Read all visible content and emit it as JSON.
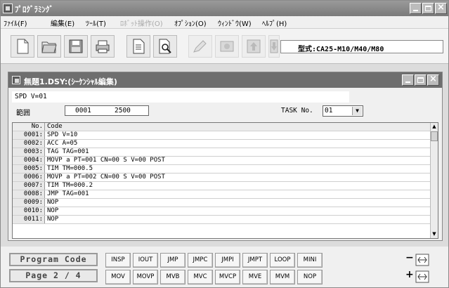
{
  "app": {
    "title": "ﾌﾟﾛｸﾞﾗﾐﾝｸﾞ"
  },
  "menu": [
    {
      "label": "ﾌｧｲﾙ(F)",
      "enabled": true
    },
    {
      "label": "編集(E)",
      "enabled": true
    },
    {
      "label": "ﾂｰﾙ(T)",
      "enabled": true
    },
    {
      "label": "ﾛﾎﾞｯﾄ操作(O)",
      "enabled": false
    },
    {
      "label": "ｵﾌﾟｼｮﾝ(O)",
      "enabled": true
    },
    {
      "label": "ｳｨﾝﾄﾞｳ(W)",
      "enabled": true
    },
    {
      "label": "ﾍﾙﾌﾟ(H)",
      "enabled": true
    }
  ],
  "toolbar": {
    "buttons": [
      "new-icon",
      "open-icon",
      "save-icon",
      "print-icon",
      "document-icon",
      "search-icon",
      "edit-icon",
      "record-icon",
      "upload-icon",
      "download-icon"
    ],
    "model_text": "型式:CA25-M10/M40/M80"
  },
  "editor": {
    "title": "無題1.DSY:(ｼｰｹﾝｼｬﾙ編集)",
    "speed_line": "SPD V=01",
    "range_label": "範囲",
    "range_start": "0001",
    "range_end": "2500",
    "task_label": "TASK No.",
    "task_value": "01",
    "columns": [
      "No.",
      "Code"
    ],
    "rows": [
      {
        "no": "0001:",
        "code": "SPD V=10"
      },
      {
        "no": "0002:",
        "code": "ACC A=05"
      },
      {
        "no": "0003:",
        "code": "TAG TAG=001"
      },
      {
        "no": "0004:",
        "code": "MOVP a PT=001 CN=00 S V=00 POST"
      },
      {
        "no": "0005:",
        "code": "TIM TM=000.5"
      },
      {
        "no": "0006:",
        "code": "MOVP a PT=002 CN=00 S V=00 POST"
      },
      {
        "no": "0007:",
        "code": "TIM TM=000.2"
      },
      {
        "no": "0008:",
        "code": "JMP TAG=001"
      },
      {
        "no": "0009:",
        "code": "NOP"
      },
      {
        "no": "0010:",
        "code": "NOP"
      },
      {
        "no": "0011:",
        "code": "NOP"
      }
    ]
  },
  "palette": {
    "mode_label": "Program Code",
    "page_label": "Page 2 / 4",
    "row1": [
      "INSP",
      "IOUT",
      "JMP",
      "JMPC",
      "JMPI",
      "JMPT",
      "LOOP",
      "MINI"
    ],
    "row2": [
      "MOV",
      "MOVP",
      "MVB",
      "MVC",
      "MVCP",
      "MVE",
      "MVM",
      "NOP"
    ],
    "minus": "−",
    "plus": "+"
  }
}
